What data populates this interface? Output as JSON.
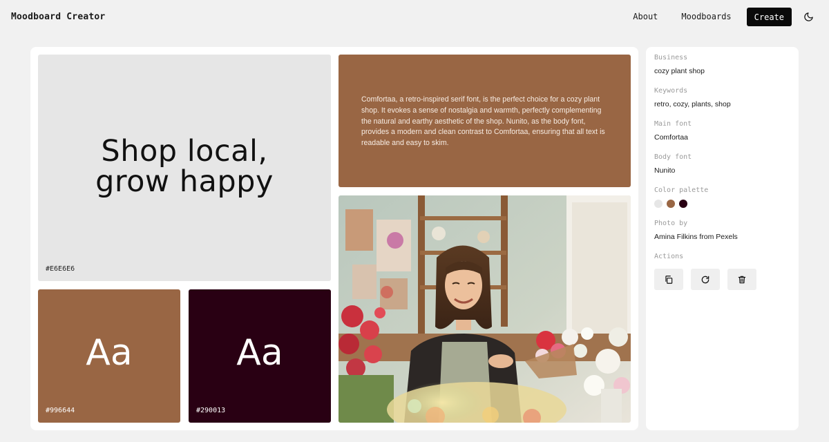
{
  "header": {
    "brand": "Moodboard Creator",
    "nav": {
      "about": "About",
      "moodboards": "Moodboards",
      "create": "Create"
    },
    "theme_icon": "moon-icon"
  },
  "board": {
    "hero": {
      "text_line1": "Shop local,",
      "text_line2": "grow happy",
      "hex": "#E6E6E6",
      "bg": "#E6E6E6"
    },
    "description": {
      "text": "Comfortaa, a retro-inspired serif font, is the perfect choice for a cozy plant shop. It evokes a sense of nostalgia and warmth, perfectly complementing the natural and earthy aesthetic of the shop. Nunito, as the body font, provides a modern and clean contrast to Comfortaa, ensuring that all text is readable and easy to skim.",
      "bg": "#996644"
    },
    "swatch_tiles": [
      {
        "sample": "Aa",
        "hex": "#996644",
        "bg": "#996644"
      },
      {
        "sample": "Aa",
        "hex": "#290013",
        "bg": "#290013"
      }
    ],
    "photo": {
      "subject": "florist smiling in flower shop"
    }
  },
  "panel": {
    "business": {
      "label": "Business",
      "value": "cozy plant shop"
    },
    "keywords": {
      "label": "Keywords",
      "value": "retro, cozy, plants, shop"
    },
    "main_font": {
      "label": "Main font",
      "value": "Comfortaa"
    },
    "body_font": {
      "label": "Body font",
      "value": "Nunito"
    },
    "palette": {
      "label": "Color palette",
      "colors": [
        "#E6E6E6",
        "#996644",
        "#290013"
      ]
    },
    "photo_by": {
      "label": "Photo by",
      "value": "Amina Filkins from Pexels"
    },
    "actions": {
      "label": "Actions",
      "icons": [
        "copy-icon",
        "refresh-icon",
        "trash-icon"
      ]
    }
  }
}
